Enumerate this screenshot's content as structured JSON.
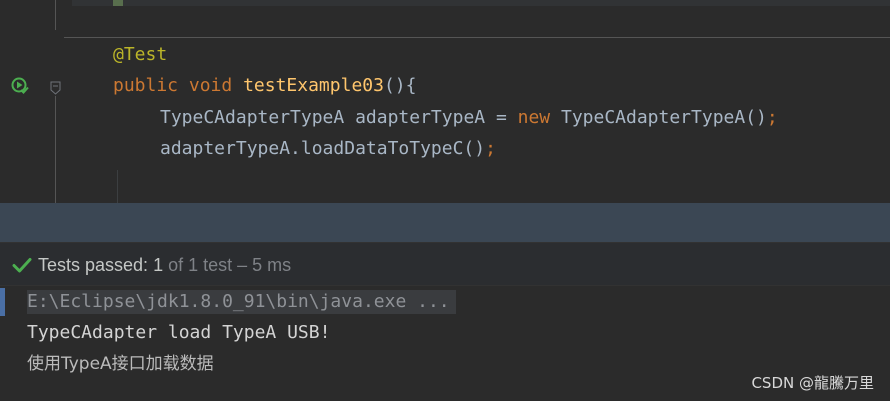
{
  "editor": {
    "lines": [
      {
        "annotation": "@Test"
      },
      {
        "kw_public": "public",
        "kw_void": "void",
        "method_name": "testExample03",
        "sig_tail": "(){"
      },
      {
        "type_name": "TypeCAdapterTypeA",
        "var_decl": " adapterTypeA = ",
        "kw_new": "new",
        "ctor": " TypeCAdapterTypeA()",
        "semicolon": ";"
      },
      {
        "call": "adapterTypeA.loadDataToTypeC()",
        "semicolon": ";"
      }
    ],
    "icons": {
      "run": "run-test-icon",
      "fold": "fold-marker-icon"
    }
  },
  "run_panel": {
    "status_label": "Tests passed: ",
    "passed_count": "1",
    "status_suffix": " of 1 test – 5 ms",
    "check_icon": "check-icon"
  },
  "console": {
    "command": "E:\\Eclipse\\jdk1.8.0_91\\bin\\java.exe ...",
    "output_line_1": "TypeCAdapter load TypeA USB!",
    "output_line_2": "使用TypeA接口加载数据"
  },
  "watermark": "CSDN @龍騰万里",
  "colors": {
    "keyword": "#cc7832",
    "method": "#ffc66d",
    "annotation": "#bbb529",
    "text": "#a9b7c6",
    "success": "#4caf50"
  }
}
